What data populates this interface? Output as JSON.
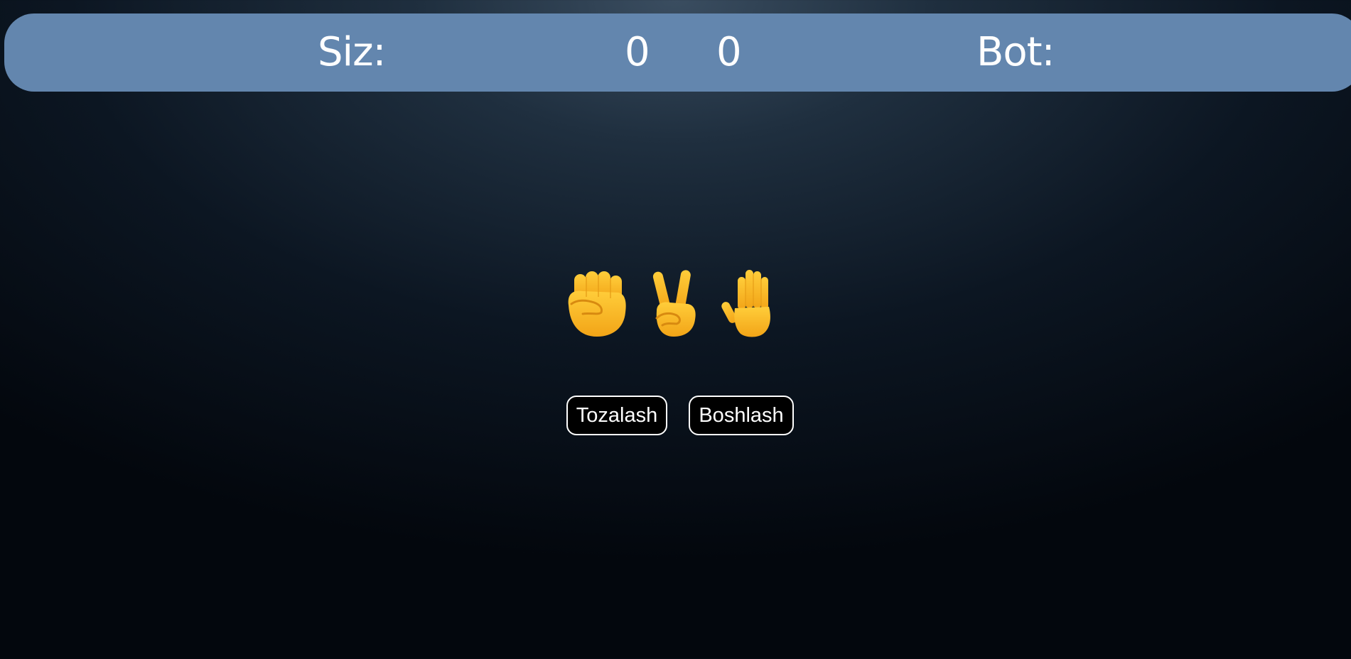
{
  "scoreboard": {
    "you_label": "Siz:",
    "you_score": "0",
    "bot_score": "0",
    "bot_label": "Bot:"
  },
  "choices": [
    {
      "name": "rock",
      "icon": "raised-fist-icon"
    },
    {
      "name": "scissors",
      "icon": "victory-hand-icon"
    },
    {
      "name": "paper",
      "icon": "raised-hand-icon"
    }
  ],
  "buttons": {
    "reset_label": "Tozalash",
    "start_label": "Boshlash"
  },
  "colors": {
    "scorebar": "#6386ae",
    "emoji": "#f8b623",
    "button_bg": "#000000",
    "button_border": "#ffffff"
  }
}
